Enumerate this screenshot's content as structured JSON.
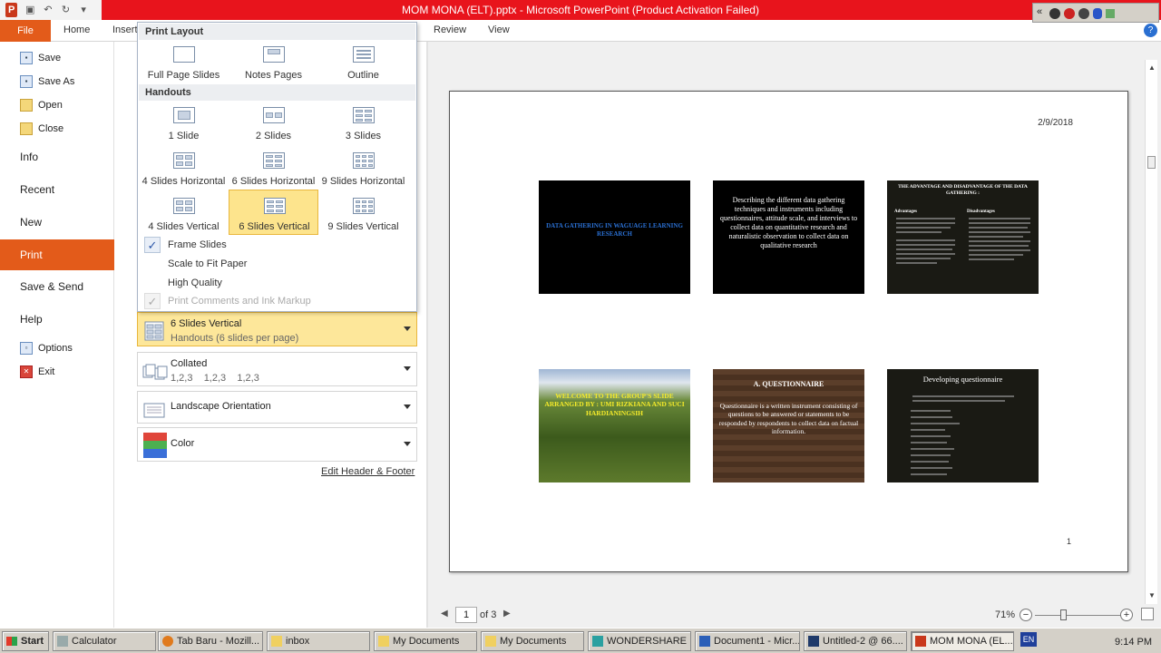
{
  "window": {
    "title": "MOM MONA (ELT).pptx - Microsoft PowerPoint (Product Activation Failed)",
    "app_initial": "P",
    "controls": [
      "–",
      "❐",
      "✕"
    ]
  },
  "ribbon": {
    "file": "File",
    "tabs": [
      "Home",
      "Insert",
      "Review",
      "View"
    ],
    "help": "?"
  },
  "backstage": {
    "items": [
      {
        "label": "Save"
      },
      {
        "label": "Save As"
      },
      {
        "label": "Open"
      },
      {
        "label": "Close"
      },
      {
        "label": "Info"
      },
      {
        "label": "Recent"
      },
      {
        "label": "New"
      },
      {
        "label": "Print"
      },
      {
        "label": "Save & Send"
      },
      {
        "label": "Help"
      },
      {
        "label": "Options"
      },
      {
        "label": "Exit"
      }
    ]
  },
  "layout_popup": {
    "print_layout_header": "Print Layout",
    "print_layout_options": [
      "Full Page Slides",
      "Notes Pages",
      "Outline"
    ],
    "handouts_header": "Handouts",
    "handout_options": [
      "1 Slide",
      "2 Slides",
      "3 Slides",
      "4 Slides Horizontal",
      "6 Slides Horizontal",
      "9 Slides Horizontal",
      "4 Slides Vertical",
      "6 Slides Vertical",
      "9 Slides Vertical"
    ],
    "selected": "6 Slides Vertical",
    "checks": [
      {
        "label": "Frame Slides",
        "checked": true,
        "disabled": false
      },
      {
        "label": "Scale to Fit Paper",
        "checked": false,
        "disabled": false
      },
      {
        "label": "High Quality",
        "checked": false,
        "disabled": false
      },
      {
        "label": "Print Comments and Ink Markup",
        "checked": true,
        "disabled": true
      }
    ]
  },
  "settings": {
    "layout": {
      "title": "6 Slides Vertical",
      "subtitle": "Handouts (6 slides per page)"
    },
    "collate": {
      "title": "Collated",
      "subtitle": "1,2,3    1,2,3    1,2,3"
    },
    "orientation": {
      "title": "Landscape Orientation"
    },
    "color": {
      "title": "Color"
    },
    "edit_header_footer": "Edit Header & Footer"
  },
  "preview": {
    "date": "2/9/2018",
    "page_number": "1",
    "slides": [
      {
        "text": "DATA GATHERING IN WAGUAGE LEARNING RESEARCH"
      },
      {
        "text": "Describing the different data gathering techniques and instruments including questionnaires, attitude scale, and interviews to collect data on quantitative research and naturalistic observation to collect data on qualitative research"
      },
      {
        "title": "THE ADVANTAGE AND DISADVANTAGE OF THE DATA GATHERING :",
        "col1_head": "Advantages",
        "col2_head": "Disadvantages"
      },
      {
        "text": "WELCOME TO THE GROUP'S SLIDE ARRANGED BY : UMI RIZKIANA AND SUCI HARDIANINGSIH"
      },
      {
        "title": "A. QUESTIONNAIRE",
        "text": "Questionnaire is a written instrument consisting of questions to be answered or statements to be responded by respondents to collect data on factual information."
      },
      {
        "title": "Developing questionnaire"
      }
    ]
  },
  "navigation": {
    "current_page": "1",
    "of_pages": "of 3",
    "zoom": "71%",
    "zoom_level_percent": 71
  },
  "taskbar": {
    "start": "Start",
    "items": [
      "Calculator",
      "Tab Baru - Mozill...",
      "inbox",
      "My Documents",
      "My Documents",
      "WONDERSHARE ...",
      "Document1 - Micr...",
      "Untitled-2 @ 66....",
      "MOM MONA (EL..."
    ],
    "active": "MOM MONA (EL...",
    "lang": "EN",
    "tray_arrows": "«",
    "clock": "9:14 PM"
  },
  "colors": {
    "title_bar": "#e8141c",
    "file_tab": "#e35b1a",
    "selected_option": "#fde48d"
  }
}
